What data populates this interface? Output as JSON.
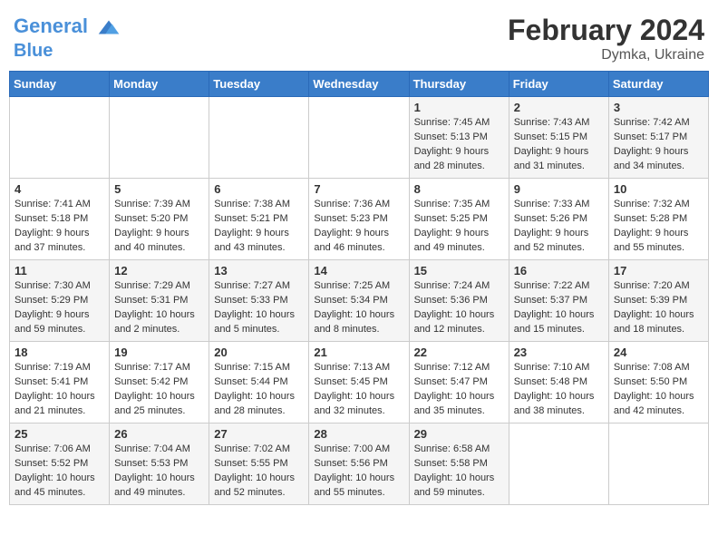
{
  "header": {
    "logo_line1": "General",
    "logo_line2": "Blue",
    "month_year": "February 2024",
    "location": "Dymka, Ukraine"
  },
  "days_of_week": [
    "Sunday",
    "Monday",
    "Tuesday",
    "Wednesday",
    "Thursday",
    "Friday",
    "Saturday"
  ],
  "weeks": [
    [
      {
        "day": "",
        "info": ""
      },
      {
        "day": "",
        "info": ""
      },
      {
        "day": "",
        "info": ""
      },
      {
        "day": "",
        "info": ""
      },
      {
        "day": "1",
        "info": "Sunrise: 7:45 AM\nSunset: 5:13 PM\nDaylight: 9 hours\nand 28 minutes."
      },
      {
        "day": "2",
        "info": "Sunrise: 7:43 AM\nSunset: 5:15 PM\nDaylight: 9 hours\nand 31 minutes."
      },
      {
        "day": "3",
        "info": "Sunrise: 7:42 AM\nSunset: 5:17 PM\nDaylight: 9 hours\nand 34 minutes."
      }
    ],
    [
      {
        "day": "4",
        "info": "Sunrise: 7:41 AM\nSunset: 5:18 PM\nDaylight: 9 hours\nand 37 minutes."
      },
      {
        "day": "5",
        "info": "Sunrise: 7:39 AM\nSunset: 5:20 PM\nDaylight: 9 hours\nand 40 minutes."
      },
      {
        "day": "6",
        "info": "Sunrise: 7:38 AM\nSunset: 5:21 PM\nDaylight: 9 hours\nand 43 minutes."
      },
      {
        "day": "7",
        "info": "Sunrise: 7:36 AM\nSunset: 5:23 PM\nDaylight: 9 hours\nand 46 minutes."
      },
      {
        "day": "8",
        "info": "Sunrise: 7:35 AM\nSunset: 5:25 PM\nDaylight: 9 hours\nand 49 minutes."
      },
      {
        "day": "9",
        "info": "Sunrise: 7:33 AM\nSunset: 5:26 PM\nDaylight: 9 hours\nand 52 minutes."
      },
      {
        "day": "10",
        "info": "Sunrise: 7:32 AM\nSunset: 5:28 PM\nDaylight: 9 hours\nand 55 minutes."
      }
    ],
    [
      {
        "day": "11",
        "info": "Sunrise: 7:30 AM\nSunset: 5:29 PM\nDaylight: 9 hours\nand 59 minutes."
      },
      {
        "day": "12",
        "info": "Sunrise: 7:29 AM\nSunset: 5:31 PM\nDaylight: 10 hours\nand 2 minutes."
      },
      {
        "day": "13",
        "info": "Sunrise: 7:27 AM\nSunset: 5:33 PM\nDaylight: 10 hours\nand 5 minutes."
      },
      {
        "day": "14",
        "info": "Sunrise: 7:25 AM\nSunset: 5:34 PM\nDaylight: 10 hours\nand 8 minutes."
      },
      {
        "day": "15",
        "info": "Sunrise: 7:24 AM\nSunset: 5:36 PM\nDaylight: 10 hours\nand 12 minutes."
      },
      {
        "day": "16",
        "info": "Sunrise: 7:22 AM\nSunset: 5:37 PM\nDaylight: 10 hours\nand 15 minutes."
      },
      {
        "day": "17",
        "info": "Sunrise: 7:20 AM\nSunset: 5:39 PM\nDaylight: 10 hours\nand 18 minutes."
      }
    ],
    [
      {
        "day": "18",
        "info": "Sunrise: 7:19 AM\nSunset: 5:41 PM\nDaylight: 10 hours\nand 21 minutes."
      },
      {
        "day": "19",
        "info": "Sunrise: 7:17 AM\nSunset: 5:42 PM\nDaylight: 10 hours\nand 25 minutes."
      },
      {
        "day": "20",
        "info": "Sunrise: 7:15 AM\nSunset: 5:44 PM\nDaylight: 10 hours\nand 28 minutes."
      },
      {
        "day": "21",
        "info": "Sunrise: 7:13 AM\nSunset: 5:45 PM\nDaylight: 10 hours\nand 32 minutes."
      },
      {
        "day": "22",
        "info": "Sunrise: 7:12 AM\nSunset: 5:47 PM\nDaylight: 10 hours\nand 35 minutes."
      },
      {
        "day": "23",
        "info": "Sunrise: 7:10 AM\nSunset: 5:48 PM\nDaylight: 10 hours\nand 38 minutes."
      },
      {
        "day": "24",
        "info": "Sunrise: 7:08 AM\nSunset: 5:50 PM\nDaylight: 10 hours\nand 42 minutes."
      }
    ],
    [
      {
        "day": "25",
        "info": "Sunrise: 7:06 AM\nSunset: 5:52 PM\nDaylight: 10 hours\nand 45 minutes."
      },
      {
        "day": "26",
        "info": "Sunrise: 7:04 AM\nSunset: 5:53 PM\nDaylight: 10 hours\nand 49 minutes."
      },
      {
        "day": "27",
        "info": "Sunrise: 7:02 AM\nSunset: 5:55 PM\nDaylight: 10 hours\nand 52 minutes."
      },
      {
        "day": "28",
        "info": "Sunrise: 7:00 AM\nSunset: 5:56 PM\nDaylight: 10 hours\nand 55 minutes."
      },
      {
        "day": "29",
        "info": "Sunrise: 6:58 AM\nSunset: 5:58 PM\nDaylight: 10 hours\nand 59 minutes."
      },
      {
        "day": "",
        "info": ""
      },
      {
        "day": "",
        "info": ""
      }
    ]
  ]
}
